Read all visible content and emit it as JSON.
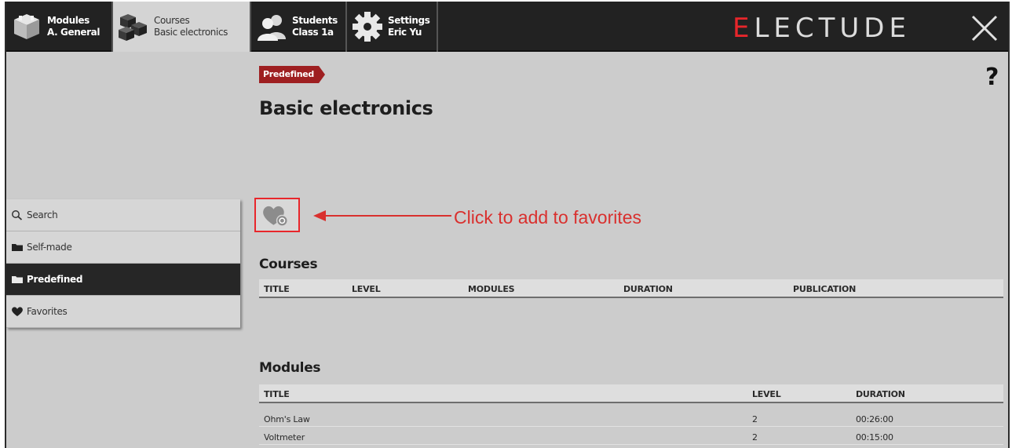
{
  "tabs": [
    {
      "line1": "Modules",
      "line2": "A. General",
      "icon": "modules-cube-icon"
    },
    {
      "line1": "Courses",
      "line2": "Basic electronics",
      "icon": "courses-cubes-icon",
      "active": true
    },
    {
      "line1": "Students",
      "line2": "Class 1a",
      "icon": "students-icon"
    },
    {
      "line1": "Settings",
      "line2": "Eric Yu",
      "icon": "gear-icon"
    }
  ],
  "brand": {
    "first_letter": "E",
    "rest": "LECTUDE",
    "accent_color": "#e8262b"
  },
  "help_label": "?",
  "badge_label": "Predefined",
  "page_title": "Basic electronics",
  "sidebar": {
    "items": [
      {
        "label": "Search",
        "icon": "search-icon"
      },
      {
        "label": "Self-made",
        "icon": "folder-icon"
      },
      {
        "label": "Predefined",
        "icon": "folder-icon",
        "active": true
      },
      {
        "label": "Favorites",
        "icon": "heart-icon"
      }
    ]
  },
  "annotation": {
    "label": "Click to add to favorites",
    "color": "#d9302e"
  },
  "courses": {
    "title": "Courses",
    "columns": [
      "TITLE",
      "LEVEL",
      "MODULES",
      "DURATION",
      "PUBLICATION"
    ],
    "rows": []
  },
  "modules": {
    "title": "Modules",
    "columns": [
      "TITLE",
      "LEVEL",
      "DURATION"
    ],
    "rows": [
      {
        "title": "Ohm's Law",
        "level": "2",
        "duration": "00:26:00"
      },
      {
        "title": "Voltmeter",
        "level": "2",
        "duration": "00:15:00"
      }
    ]
  }
}
